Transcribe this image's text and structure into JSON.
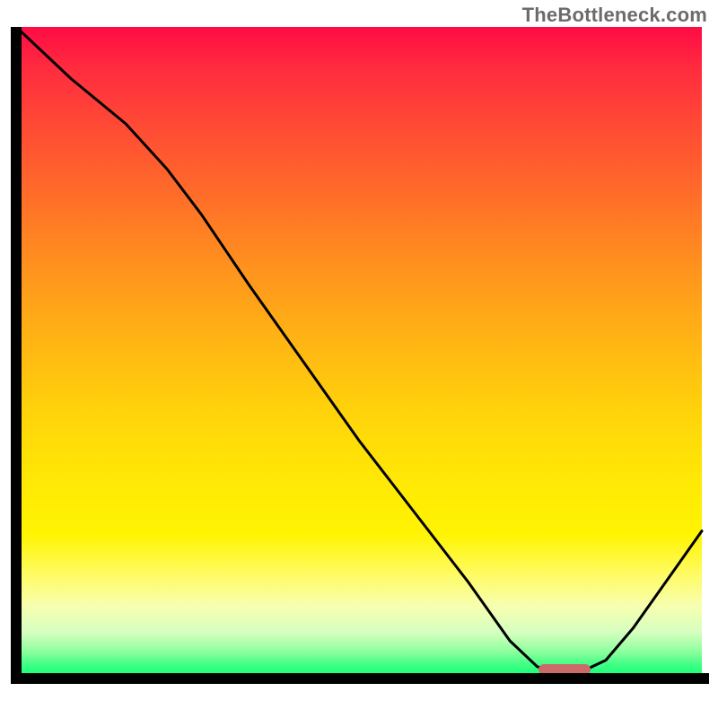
{
  "watermark": "TheBottleneck.com",
  "colors": {
    "axis": "#000000",
    "curve": "#000000",
    "marker": "#cc6a6a",
    "gradient_top": "#ff0b45",
    "gradient_bottom": "#0aff77"
  },
  "chart_data": {
    "type": "line",
    "title": "",
    "xlabel": "",
    "ylabel": "",
    "xlim": [
      0,
      100
    ],
    "ylim": [
      0,
      100
    ],
    "grid": false,
    "legend": false,
    "x": [
      0,
      8,
      16,
      22,
      27,
      34,
      42,
      50,
      58,
      66,
      72,
      76,
      79,
      82,
      86,
      90,
      94,
      100
    ],
    "values": [
      100,
      92,
      85,
      78,
      71,
      60,
      48,
      36,
      25,
      14,
      5,
      1,
      0,
      0,
      2,
      7,
      13,
      22
    ],
    "marker": {
      "x": 80,
      "y": 0
    },
    "background": "vertical heat gradient red→orange→yellow→green"
  }
}
